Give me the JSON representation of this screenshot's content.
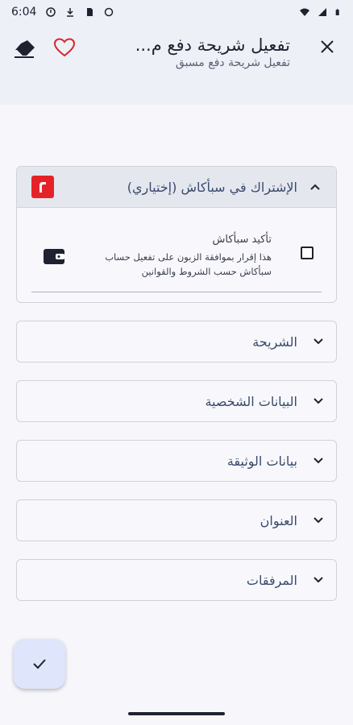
{
  "status_bar": {
    "time": "6:04",
    "icons": [
      "alert-icon",
      "download-icon",
      "sim-icon",
      "sync-icon",
      "wifi-icon",
      "signal-icon",
      "battery-icon"
    ]
  },
  "app_bar": {
    "title": "تفعيل شريحة دفع م...",
    "subtitle": "تفعيل شريحة دفع مسبق",
    "icons": [
      "close-icon",
      "heart-icon",
      "eraser-icon"
    ],
    "heart_color": "#d62828"
  },
  "sapcash": {
    "title": "الإشتراك في سبأكاش (إختياري)",
    "logo_color": "#e62229",
    "confirm_title": "تأكيد سبأكاش",
    "confirm_desc": "هذا إقرار بموافقة الزبون على تفعيل حساب سبأكاش حسب الشروط والقوانين"
  },
  "sections": [
    {
      "label": "الشريحة"
    },
    {
      "label": "البيانات الشخصية"
    },
    {
      "label": "بيانات الوثيقة"
    },
    {
      "label": "العنوان"
    },
    {
      "label": "المرفقات"
    }
  ],
  "fab": {
    "icon": "check-icon"
  }
}
